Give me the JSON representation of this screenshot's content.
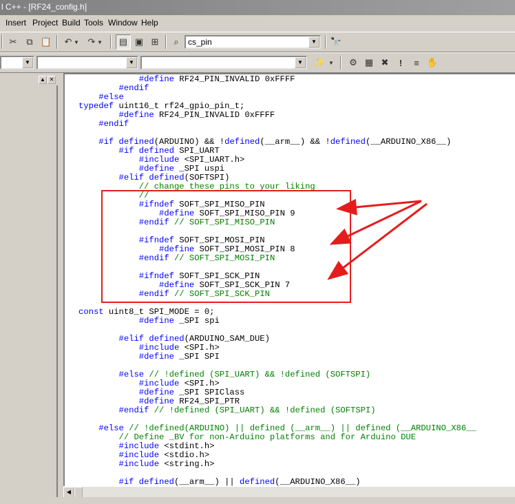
{
  "window": {
    "title": "l C++ - [RF24_config.h]"
  },
  "menu": [
    {
      "label": "Insert"
    },
    {
      "label": "Project"
    },
    {
      "label": "Build"
    },
    {
      "label": "Tools"
    },
    {
      "label": "Window"
    },
    {
      "label": "Help"
    }
  ],
  "toolbar": {
    "find_combo_value": "cs_pin",
    "class_combo_value": "",
    "member_combo_value": "",
    "function_combo_value": ""
  },
  "editor": {
    "file_name": "RF24_config.h",
    "lines": [
      [
        {
          "t": "            "
        },
        {
          "t": "#define",
          "c": "kw"
        },
        {
          "t": " RF24_PIN_INVALID 0xFFFF"
        }
      ],
      [
        {
          "t": "        "
        },
        {
          "t": "#endif",
          "c": "kw"
        }
      ],
      [
        {
          "t": "    "
        },
        {
          "t": "#else",
          "c": "kw"
        }
      ],
      [
        {
          "t": "typedef",
          "c": "kw"
        },
        {
          "t": " uint16_t rf24_gpio_pin_t;"
        }
      ],
      [
        {
          "t": "        "
        },
        {
          "t": "#define",
          "c": "kw"
        },
        {
          "t": " RF24_PIN_INVALID 0xFFFF"
        }
      ],
      [
        {
          "t": "    "
        },
        {
          "t": "#endif",
          "c": "kw"
        }
      ],
      [
        {
          "t": ""
        }
      ],
      [
        {
          "t": "    "
        },
        {
          "t": "#if defined",
          "c": "kw"
        },
        {
          "t": "(ARDUINO) && !"
        },
        {
          "t": "defined",
          "c": "kw"
        },
        {
          "t": "(__arm__) && !"
        },
        {
          "t": "defined",
          "c": "kw"
        },
        {
          "t": "(__ARDUINO_X86__)"
        }
      ],
      [
        {
          "t": "        "
        },
        {
          "t": "#if defined",
          "c": "kw"
        },
        {
          "t": " SPI_UART"
        }
      ],
      [
        {
          "t": "            "
        },
        {
          "t": "#include",
          "c": "kw"
        },
        {
          "t": " <SPI_UART.h>"
        }
      ],
      [
        {
          "t": "            "
        },
        {
          "t": "#define",
          "c": "kw"
        },
        {
          "t": " _SPI uspi"
        }
      ],
      [
        {
          "t": "        "
        },
        {
          "t": "#elif defined",
          "c": "kw"
        },
        {
          "t": "(SOFTSPI)"
        }
      ],
      [
        {
          "t": "            "
        },
        {
          "t": "// change these pins to your liking",
          "c": "cm"
        }
      ],
      [
        {
          "t": "            "
        },
        {
          "t": "//",
          "c": "cm"
        }
      ],
      [
        {
          "t": "            "
        },
        {
          "t": "#ifndef",
          "c": "kw"
        },
        {
          "t": " SOFT_SPI_MISO_PIN"
        }
      ],
      [
        {
          "t": "                "
        },
        {
          "t": "#define",
          "c": "kw"
        },
        {
          "t": " SOFT_SPI_MISO_PIN 9"
        }
      ],
      [
        {
          "t": "            "
        },
        {
          "t": "#endif",
          "c": "kw"
        },
        {
          "t": " "
        },
        {
          "t": "// SOFT_SPI_MISO_PIN",
          "c": "cm"
        }
      ],
      [
        {
          "t": ""
        }
      ],
      [
        {
          "t": "            "
        },
        {
          "t": "#ifndef",
          "c": "kw"
        },
        {
          "t": " SOFT_SPI_MOSI_PIN"
        }
      ],
      [
        {
          "t": "                "
        },
        {
          "t": "#define",
          "c": "kw"
        },
        {
          "t": " SOFT_SPI_MOSI_PIN 8"
        }
      ],
      [
        {
          "t": "            "
        },
        {
          "t": "#endif",
          "c": "kw"
        },
        {
          "t": " "
        },
        {
          "t": "// SOFT_SPI_MOSI_PIN",
          "c": "cm"
        }
      ],
      [
        {
          "t": ""
        }
      ],
      [
        {
          "t": "            "
        },
        {
          "t": "#ifndef",
          "c": "kw"
        },
        {
          "t": " SOFT_SPI_SCK_PIN"
        }
      ],
      [
        {
          "t": "                "
        },
        {
          "t": "#define",
          "c": "kw"
        },
        {
          "t": " SOFT_SPI_SCK_PIN 7"
        }
      ],
      [
        {
          "t": "            "
        },
        {
          "t": "#endif",
          "c": "kw"
        },
        {
          "t": " "
        },
        {
          "t": "// SOFT_SPI_SCK_PIN",
          "c": "cm"
        }
      ],
      [
        {
          "t": ""
        }
      ],
      [
        {
          "t": "const",
          "c": "kw"
        },
        {
          "t": " uint8_t SPI_MODE = 0;"
        }
      ],
      [
        {
          "t": "            "
        },
        {
          "t": "#define",
          "c": "kw"
        },
        {
          "t": " _SPI spi"
        }
      ],
      [
        {
          "t": ""
        }
      ],
      [
        {
          "t": "        "
        },
        {
          "t": "#elif defined",
          "c": "kw"
        },
        {
          "t": "(ARDUINO_SAM_DUE)"
        }
      ],
      [
        {
          "t": "            "
        },
        {
          "t": "#include",
          "c": "kw"
        },
        {
          "t": " <SPI.h>"
        }
      ],
      [
        {
          "t": "            "
        },
        {
          "t": "#define",
          "c": "kw"
        },
        {
          "t": " _SPI SPI"
        }
      ],
      [
        {
          "t": ""
        }
      ],
      [
        {
          "t": "        "
        },
        {
          "t": "#else",
          "c": "kw"
        },
        {
          "t": " "
        },
        {
          "t": "// !defined (SPI_UART) && !defined (SOFTSPI)",
          "c": "cm"
        }
      ],
      [
        {
          "t": "            "
        },
        {
          "t": "#include",
          "c": "kw"
        },
        {
          "t": " <SPI.h>"
        }
      ],
      [
        {
          "t": "            "
        },
        {
          "t": "#define",
          "c": "kw"
        },
        {
          "t": " _SPI SPIClass"
        }
      ],
      [
        {
          "t": "            "
        },
        {
          "t": "#define",
          "c": "kw"
        },
        {
          "t": " RF24_SPI_PTR"
        }
      ],
      [
        {
          "t": "        "
        },
        {
          "t": "#endif",
          "c": "kw"
        },
        {
          "t": " "
        },
        {
          "t": "// !defined (SPI_UART) && !defined (SOFTSPI)",
          "c": "cm"
        }
      ],
      [
        {
          "t": ""
        }
      ],
      [
        {
          "t": "    "
        },
        {
          "t": "#else",
          "c": "kw"
        },
        {
          "t": " "
        },
        {
          "t": "// !defined(ARDUINO) || defined (__arm__) || defined (__ARDUINO_X86__",
          "c": "cm"
        }
      ],
      [
        {
          "t": "        "
        },
        {
          "t": "// Define _BV for non-Arduino platforms and for Arduino DUE",
          "c": "cm"
        }
      ],
      [
        {
          "t": "        "
        },
        {
          "t": "#include",
          "c": "kw"
        },
        {
          "t": " <stdint.h>"
        }
      ],
      [
        {
          "t": "        "
        },
        {
          "t": "#include",
          "c": "kw"
        },
        {
          "t": " <stdio.h>"
        }
      ],
      [
        {
          "t": "        "
        },
        {
          "t": "#include",
          "c": "kw"
        },
        {
          "t": " <string.h>"
        }
      ],
      [
        {
          "t": ""
        }
      ],
      [
        {
          "t": "        "
        },
        {
          "t": "#if defined",
          "c": "kw"
        },
        {
          "t": "(__arm__) || "
        },
        {
          "t": "defined",
          "c": "kw"
        },
        {
          "t": "(__ARDUINO_X86__)"
        }
      ]
    ]
  },
  "colors": {
    "keyword": "#0000ff",
    "comment": "#008000",
    "annotation": "#e51c1c"
  },
  "icons": [
    "cut-icon",
    "copy-icon",
    "paste-icon",
    "undo-icon",
    "redo-icon",
    "workspace-icon",
    "output-icon",
    "window-list-icon",
    "find-in-files-icon",
    "find-icon",
    "wizard-icon",
    "compile-icon",
    "build-icon",
    "stop-build-icon",
    "build-error-icon",
    "execute-icon",
    "breakpoint-icon"
  ]
}
